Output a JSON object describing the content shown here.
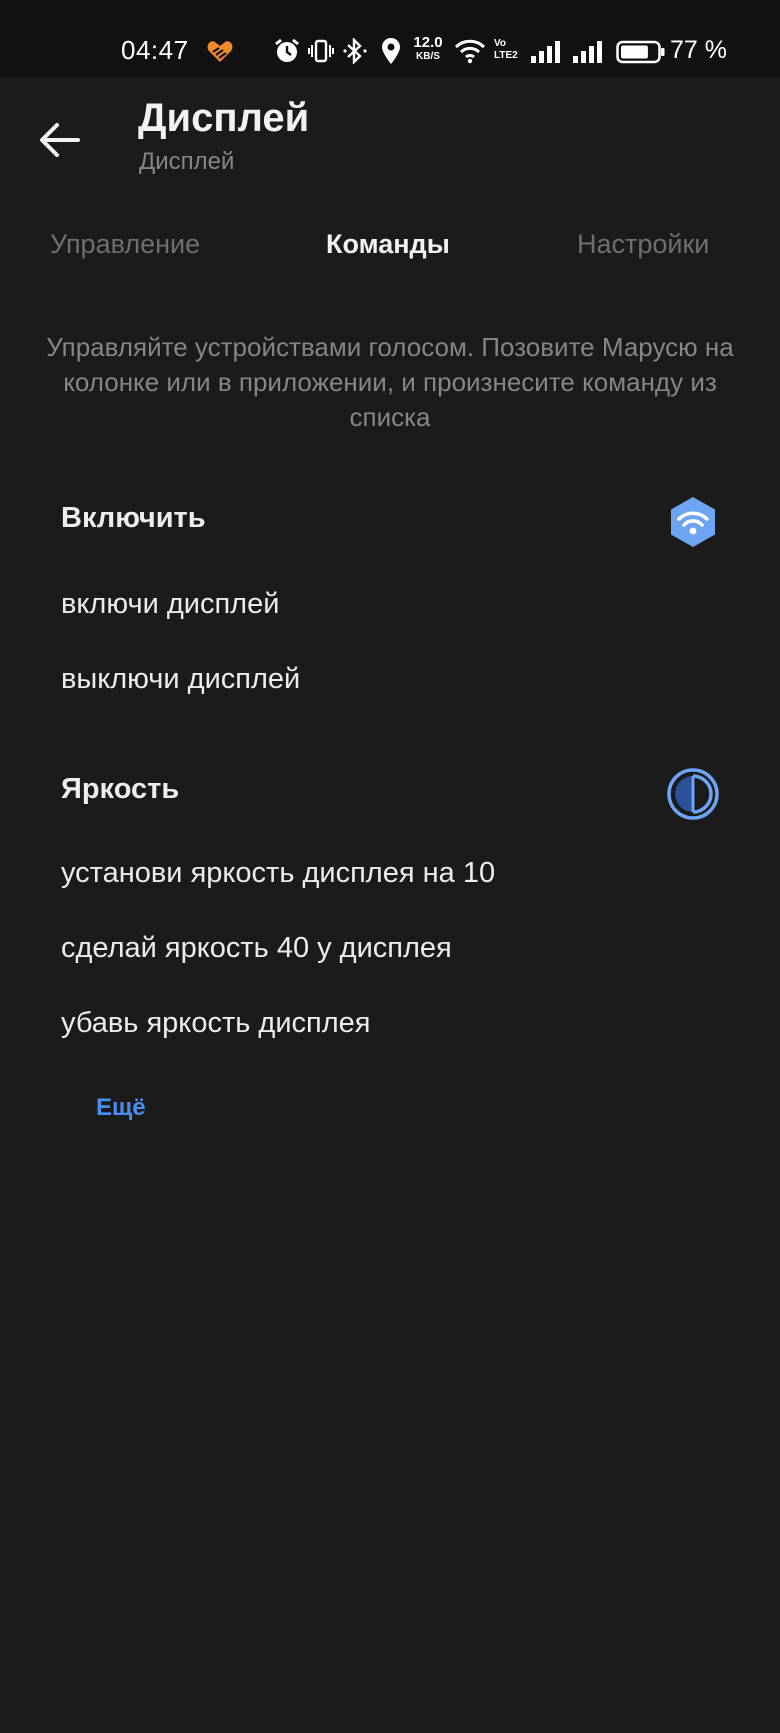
{
  "status_bar": {
    "time": "04:47",
    "net_speed_value": "12.0",
    "net_speed_unit": "KB/S",
    "volte_top": "Vo",
    "volte_bottom": "LTE2",
    "battery_percent": "77 %",
    "battery_level": 0.77,
    "icons": [
      "heart-app-icon",
      "alarm-icon",
      "vibrate-icon",
      "bluetooth-icon",
      "location-icon",
      "wifi-icon",
      "signal-icon",
      "battery-icon"
    ]
  },
  "header": {
    "title": "Дисплей",
    "subtitle": "Дисплей",
    "back_icon": "arrow-left-icon"
  },
  "tabs": [
    {
      "label": "Управление",
      "active": false
    },
    {
      "label": "Команды",
      "active": true
    },
    {
      "label": "Настройки",
      "active": false
    }
  ],
  "intro": {
    "text": "Управляйте устройствами голосом. Позовите Марусю на колонке или в приложении, и произнесите команду из списка"
  },
  "sections": [
    {
      "title": "Включить",
      "icon": "power-wifi-hexagon-icon",
      "commands": [
        "включи дисплей",
        "выключи дисплей"
      ]
    },
    {
      "title": "Яркость",
      "icon": "brightness-contrast-icon",
      "commands": [
        "установи яркость дисплея на 10",
        "сделай яркость 40 у дисплея",
        "убавь яркость дисплея"
      ]
    }
  ],
  "more_link": "Ещё",
  "colors": {
    "background": "#1b1b1c",
    "status_bar": "#111112",
    "accent": "#4b8ef2",
    "icon_blue": "#6ea4f4",
    "muted_text": "#85858a",
    "heart_orange": "#f08a2c"
  }
}
